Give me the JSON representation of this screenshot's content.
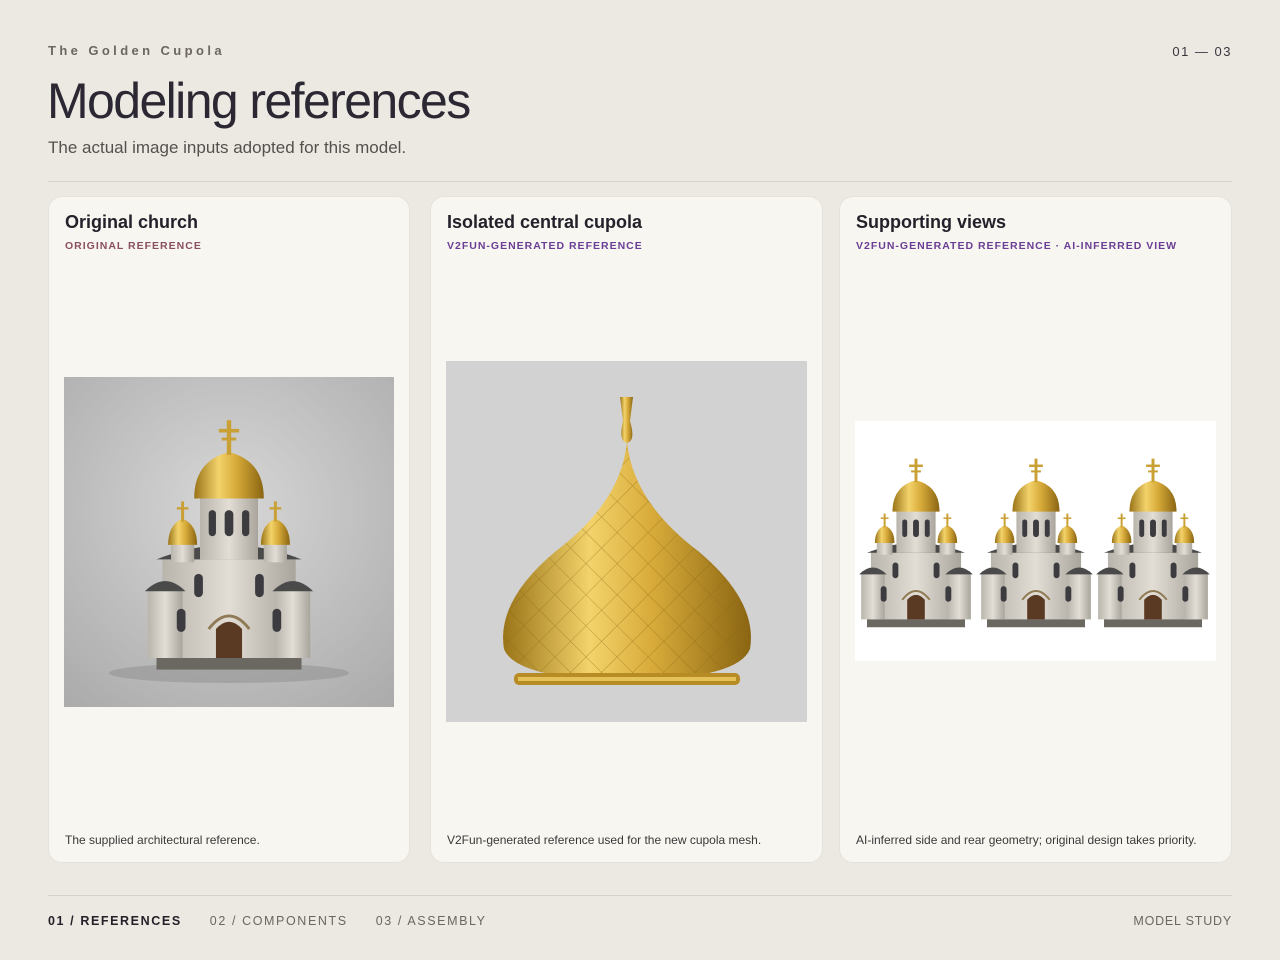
{
  "header": {
    "eyebrow": "The Golden Cupola",
    "pager": "01 — 03",
    "title": "Modeling references",
    "subtitle": "The actual image inputs adopted for this model."
  },
  "cards": [
    {
      "title": "Original church",
      "tag": "ORIGINAL REFERENCE",
      "tag_color": "#8a4f60",
      "caption": "The supplied architectural reference."
    },
    {
      "title": "Isolated central cupola",
      "tag": "V2FUN-GENERATED REFERENCE",
      "tag_color": "#6a3e95",
      "caption": "V2Fun-generated reference used for the new cupola mesh."
    },
    {
      "title": "Supporting views",
      "tag": "V2FUN-GENERATED REFERENCE · AI-INFERRED VIEW",
      "tag_color": "#6a3e95",
      "caption": "AI-inferred side and rear geometry; original design takes priority."
    }
  ],
  "footer": {
    "nav": [
      {
        "label": "01 / REFERENCES",
        "active": true
      },
      {
        "label": "02 / COMPONENTS",
        "active": false
      },
      {
        "label": "03 / ASSEMBLY",
        "active": false
      }
    ],
    "label": "MODEL STUDY"
  },
  "colors": {
    "background": "#ece9e2",
    "card": "#f7f6f1",
    "gold": "#c9a033"
  }
}
